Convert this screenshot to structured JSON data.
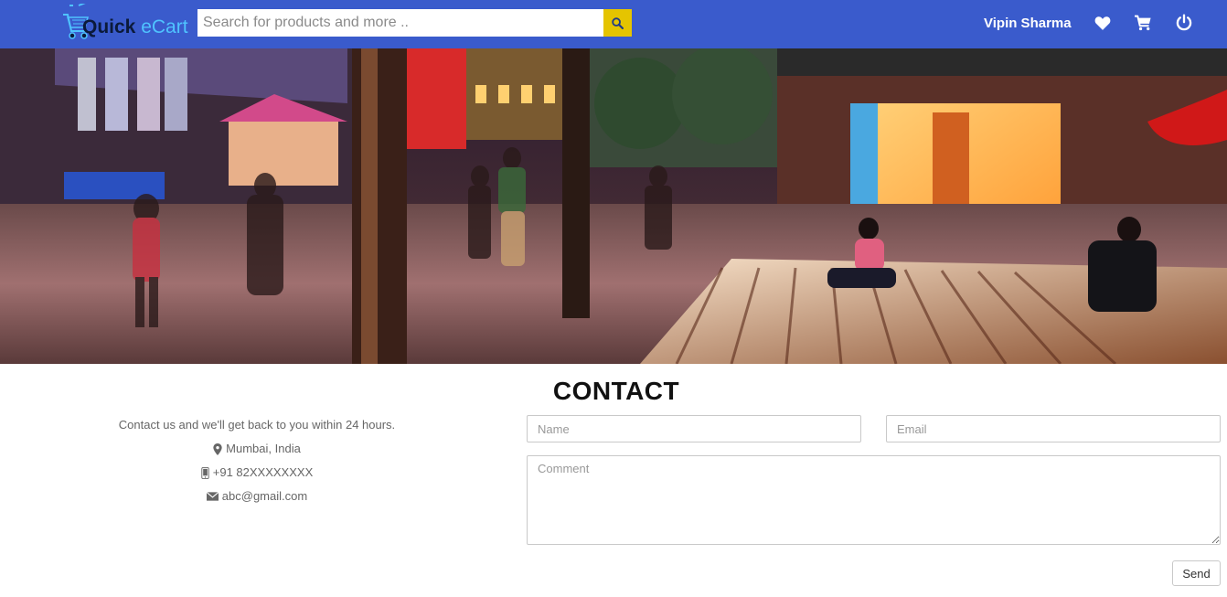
{
  "navbar": {
    "logo": {
      "word1": "Quick",
      "word2": " eCart"
    },
    "search": {
      "placeholder": "Search for products and more .."
    },
    "user_name": "Vipin Sharma",
    "colors": {
      "background": "#3a5bcc",
      "search_button": "#e5c400"
    },
    "icons": [
      "search-icon",
      "heart-icon",
      "cart-icon",
      "power-icon"
    ]
  },
  "banner": {
    "alt": "Night street shopping district"
  },
  "contact": {
    "title": "CONTACT",
    "intro": "Contact us and we'll get back to you within 24 hours.",
    "location": "Mumbai, India",
    "phone": "+91 82XXXXXXXX",
    "email": "abc@gmail.com",
    "form": {
      "name_placeholder": "Name",
      "email_placeholder": "Email",
      "comment_placeholder": "Comment",
      "send_label": "Send"
    }
  }
}
